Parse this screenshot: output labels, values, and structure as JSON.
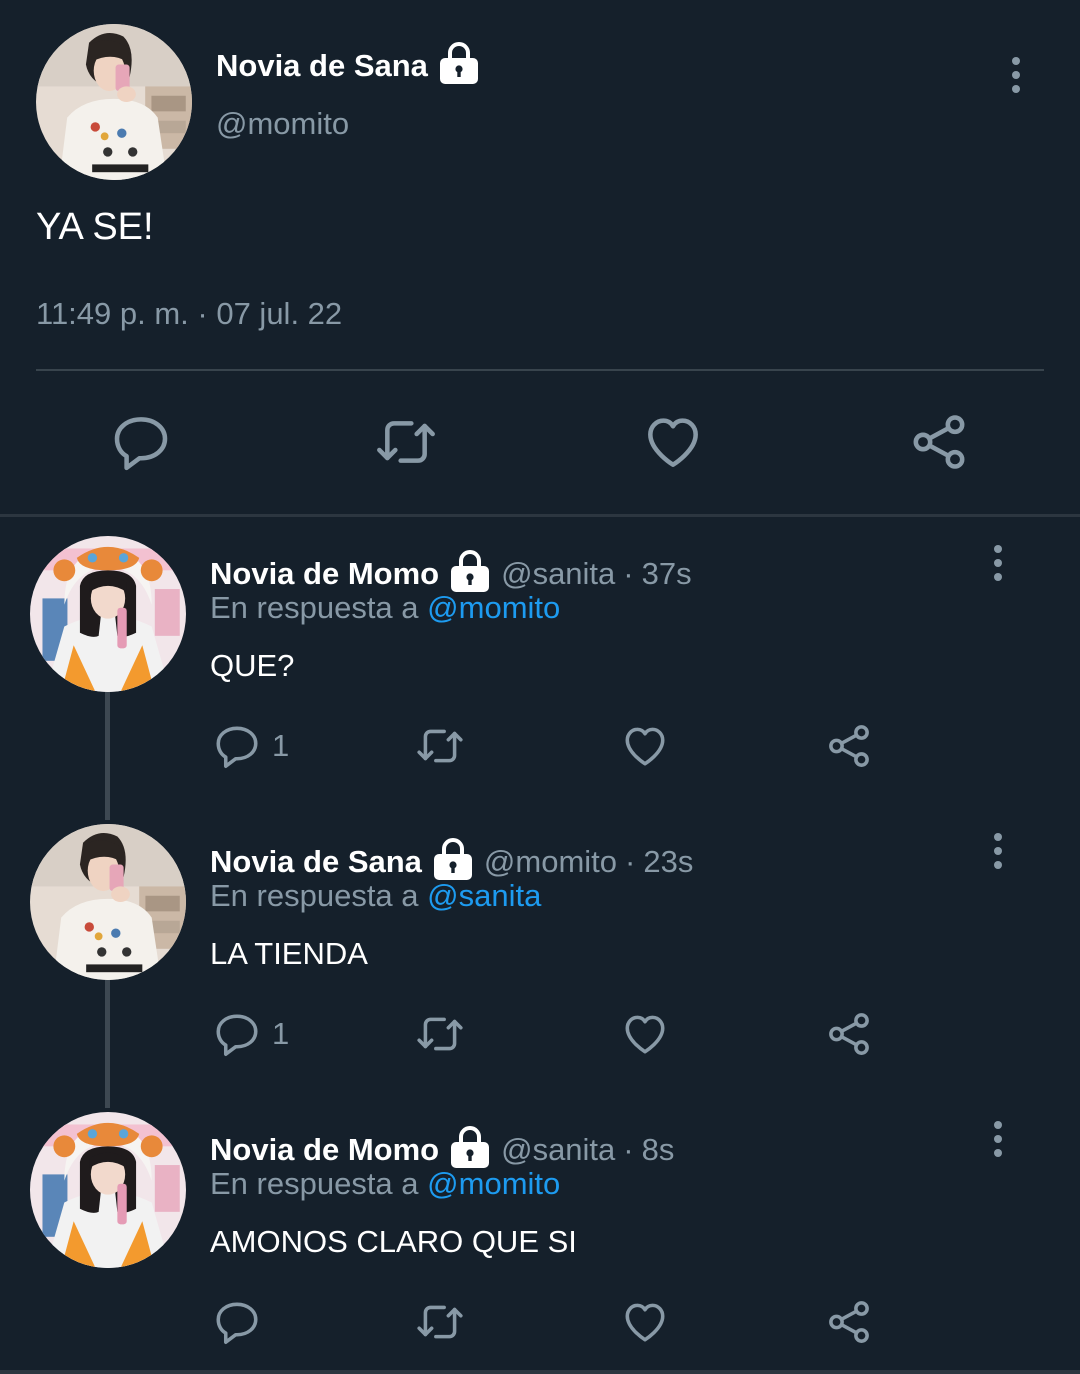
{
  "main_tweet": {
    "display_name": "Novia de Sana",
    "handle": "@momito",
    "text": "YA SE!",
    "timestamp": "11:49 p. m. · 07 jul. 22",
    "lock_icon": "lock-icon",
    "avatar": "girl-white-sweater-selfie"
  },
  "replies": [
    {
      "display_name": "Novia de Momo",
      "handle": "@sanita",
      "dot": "·",
      "ago": "37s",
      "in_reply_prefix": "En respuesta a",
      "in_reply_to": "@momito",
      "text": "QUE?",
      "reply_count": "1",
      "avatar": "girl-animal-hood"
    },
    {
      "display_name": "Novia de Sana",
      "handle": "@momito",
      "dot": "·",
      "ago": "23s",
      "in_reply_prefix": "En respuesta a",
      "in_reply_to": "@sanita",
      "text": "LA TIENDA",
      "reply_count": "1",
      "avatar": "girl-white-sweater-selfie"
    },
    {
      "display_name": "Novia de Momo",
      "handle": "@sanita",
      "dot": "·",
      "ago": "8s",
      "in_reply_prefix": "En respuesta a",
      "in_reply_to": "@momito",
      "text": "AMONOS CLARO QUE SI",
      "reply_count": "",
      "avatar": "girl-animal-hood"
    }
  ],
  "colors": {
    "background": "#15202b",
    "secondary_text": "#8899a6",
    "link": "#1d9bf0",
    "divider": "#38444d"
  },
  "icons": [
    "reply-icon",
    "retweet-icon",
    "like-icon",
    "share-icon",
    "more-icon",
    "lock-icon"
  ]
}
